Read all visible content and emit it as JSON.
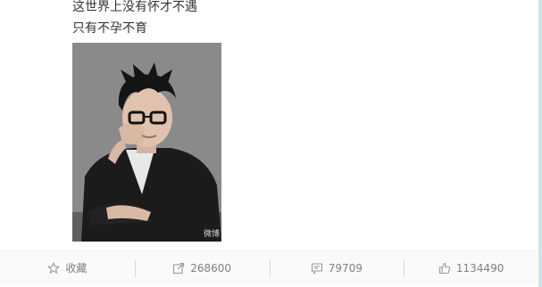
{
  "post": {
    "lines": [
      "这世界上没有怀才不遇",
      "只有不孕不育"
    ],
    "image": {
      "alt": "portrait photo",
      "watermark": "微博"
    }
  },
  "actions": [
    {
      "name": "favorite",
      "icon": "star-icon",
      "label": "收藏"
    },
    {
      "name": "repost",
      "icon": "share-icon",
      "label": "268600"
    },
    {
      "name": "comment",
      "icon": "comment-icon",
      "label": "79709"
    },
    {
      "name": "like",
      "icon": "thumbs-up-icon",
      "label": "1134490"
    }
  ]
}
